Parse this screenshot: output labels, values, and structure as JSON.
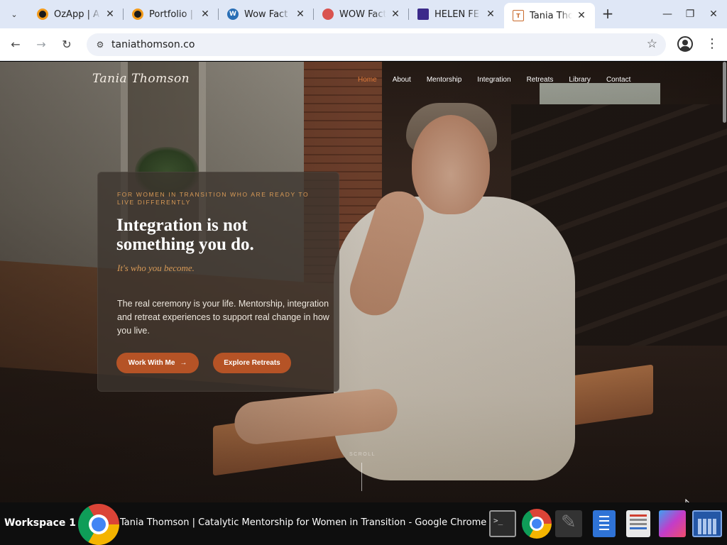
{
  "browser": {
    "tabs": [
      {
        "title": "OzApp | A",
        "favicon_color": "#f29a1a",
        "favicon_icon": "circle-logo"
      },
      {
        "title": "Portfolio |",
        "favicon_color": "#f29a1a",
        "favicon_icon": "circle-logo"
      },
      {
        "title": "Wow Fact",
        "favicon_color": "#2a6fb6",
        "favicon_icon": "wordpress-logo"
      },
      {
        "title": "WOW Fact",
        "favicon_color": "#d9534f",
        "favicon_icon": "wow-logo"
      },
      {
        "title": "HELEN FE",
        "favicon_color": "#3b2a8a",
        "favicon_icon": "square-logo"
      },
      {
        "title": "Tania Tho",
        "favicon_color": "#c86a2c",
        "favicon_icon": "tt-logo",
        "active": true
      }
    ],
    "url": "taniathomson.co"
  },
  "site": {
    "logo": "Tania Thomson",
    "nav": [
      "Home",
      "About",
      "Mentorship",
      "Integration",
      "Retreats",
      "Library",
      "Contact"
    ],
    "active_nav": "Home",
    "accent_color": "#e07b39",
    "hero": {
      "kicker": "FOR WOMEN IN TRANSITION WHO ARE READY TO LIVE DIFFERENTLY",
      "title_line1": "Integration is not",
      "title_line2": "something you do.",
      "subtitle": "It's who you become.",
      "body": "The real ceremony is your life. Mentorship, integration and retreat experiences to support real change in how you live.",
      "primary_button": "Work With Me",
      "primary_button_icon": "arrow-right-icon",
      "secondary_button": "Explore Retreats",
      "button_color": "#b55326"
    },
    "scroll_label": "SCROLL"
  },
  "taskbar": {
    "workspace": "Workspace 1",
    "window_title": "Tania Thomson | Catalytic Mentorship for Women in Transition - Google Chrome"
  }
}
